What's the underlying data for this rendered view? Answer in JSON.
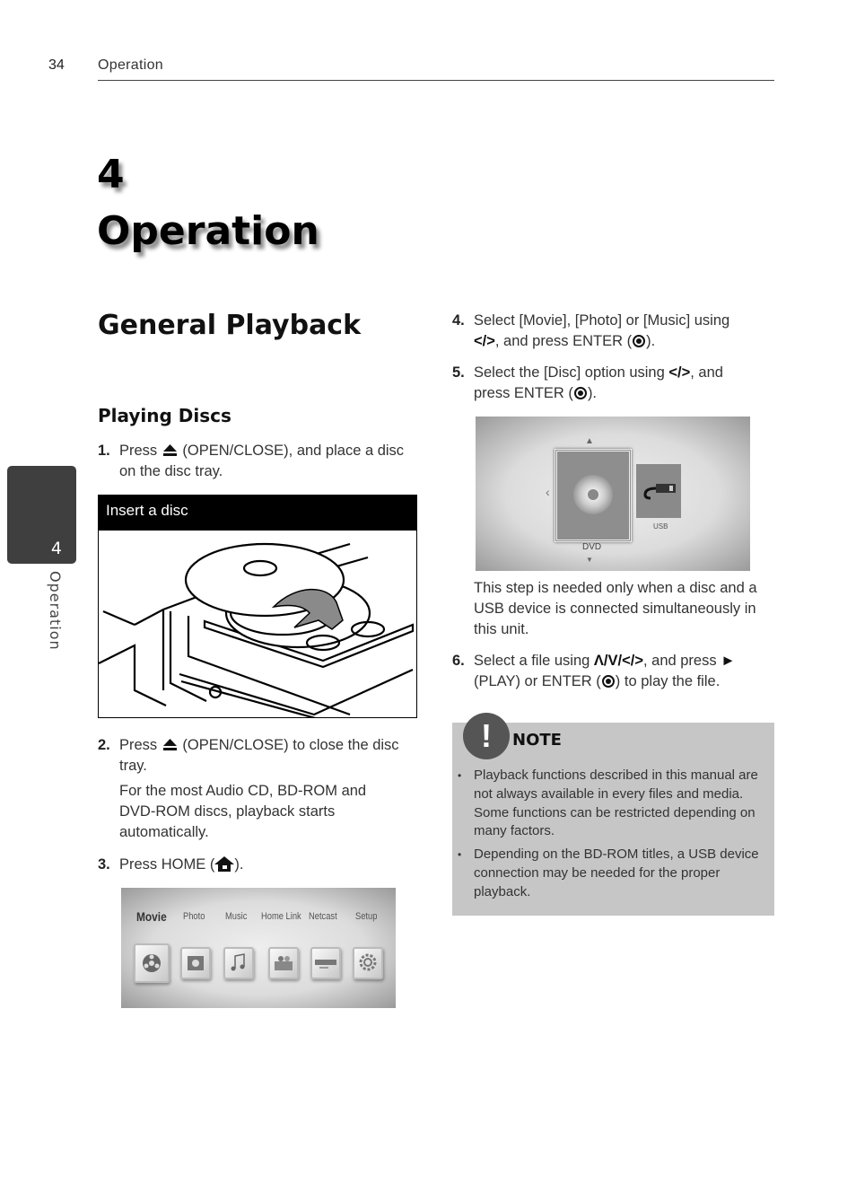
{
  "header": {
    "page_number": "34",
    "section": "Operation"
  },
  "chapter": {
    "number": "4",
    "title": "Operation"
  },
  "side_tab": {
    "number": "4",
    "label": "Operation"
  },
  "section_title": "General Playback",
  "subsection_title": "Playing Discs",
  "steps": [
    {
      "num": "1.",
      "pre": "Press",
      "icon": "eject-icon",
      "post": "(OPEN/CLOSE), and place a disc on the disc tray."
    },
    {
      "num": "2.",
      "pre": "Press",
      "icon": "eject-icon",
      "post": "(OPEN/CLOSE) to close the disc tray.",
      "extra": "For the most Audio CD, BD-ROM and DVD-ROM discs, playback starts automatically."
    },
    {
      "num": "3.",
      "pre": "Press HOME (",
      "icon": "home-icon",
      "post": ")."
    },
    {
      "num": "4.",
      "line1": "Select [Movie], [Photo] or [Music] using",
      "sym": "</>",
      "line2": ", and press ENTER (",
      "end": ")."
    },
    {
      "num": "5.",
      "line1": "Select the [Disc] option using",
      "sym": "</>",
      "line2": ", and",
      "line3": "press ENTER (",
      "end": ")."
    },
    {
      "num": "6.",
      "line1": "Select a file using",
      "sym": "Λ/V/</>",
      "line2": ", and press",
      "play": "►",
      "line3": "(PLAY) or ENTER (",
      "end": ") to play the file."
    }
  ],
  "figure_insert": {
    "caption": "Insert a disc"
  },
  "home_menu": {
    "items": [
      {
        "label": "Movie",
        "icon": "movie-reel-icon",
        "selected": true
      },
      {
        "label": "Photo",
        "icon": "photo-icon",
        "selected": false
      },
      {
        "label": "Music",
        "icon": "music-note-icon",
        "selected": false
      },
      {
        "label": "Home Link",
        "icon": "home-link-icon",
        "selected": false
      },
      {
        "label": "Netcast",
        "icon": "netcast-icon",
        "selected": false
      },
      {
        "label": "Setup",
        "icon": "gear-icon",
        "selected": false
      }
    ]
  },
  "device_menu": {
    "items": [
      {
        "label": "DVD",
        "icon": "disc-icon",
        "selected": true
      },
      {
        "label": "USB",
        "icon": "usb-icon",
        "selected": false
      }
    ]
  },
  "step5_note": "This step is needed only when a disc and a USB device is connected simultaneously in this unit.",
  "note": {
    "badge": "!",
    "title": "NOTE",
    "items": [
      "Playback functions described in this manual are not always available in every files and media. Some functions can be restricted depending on many factors.",
      "Depending on the BD-ROM titles, a USB device connection may be needed for the proper playback."
    ]
  }
}
